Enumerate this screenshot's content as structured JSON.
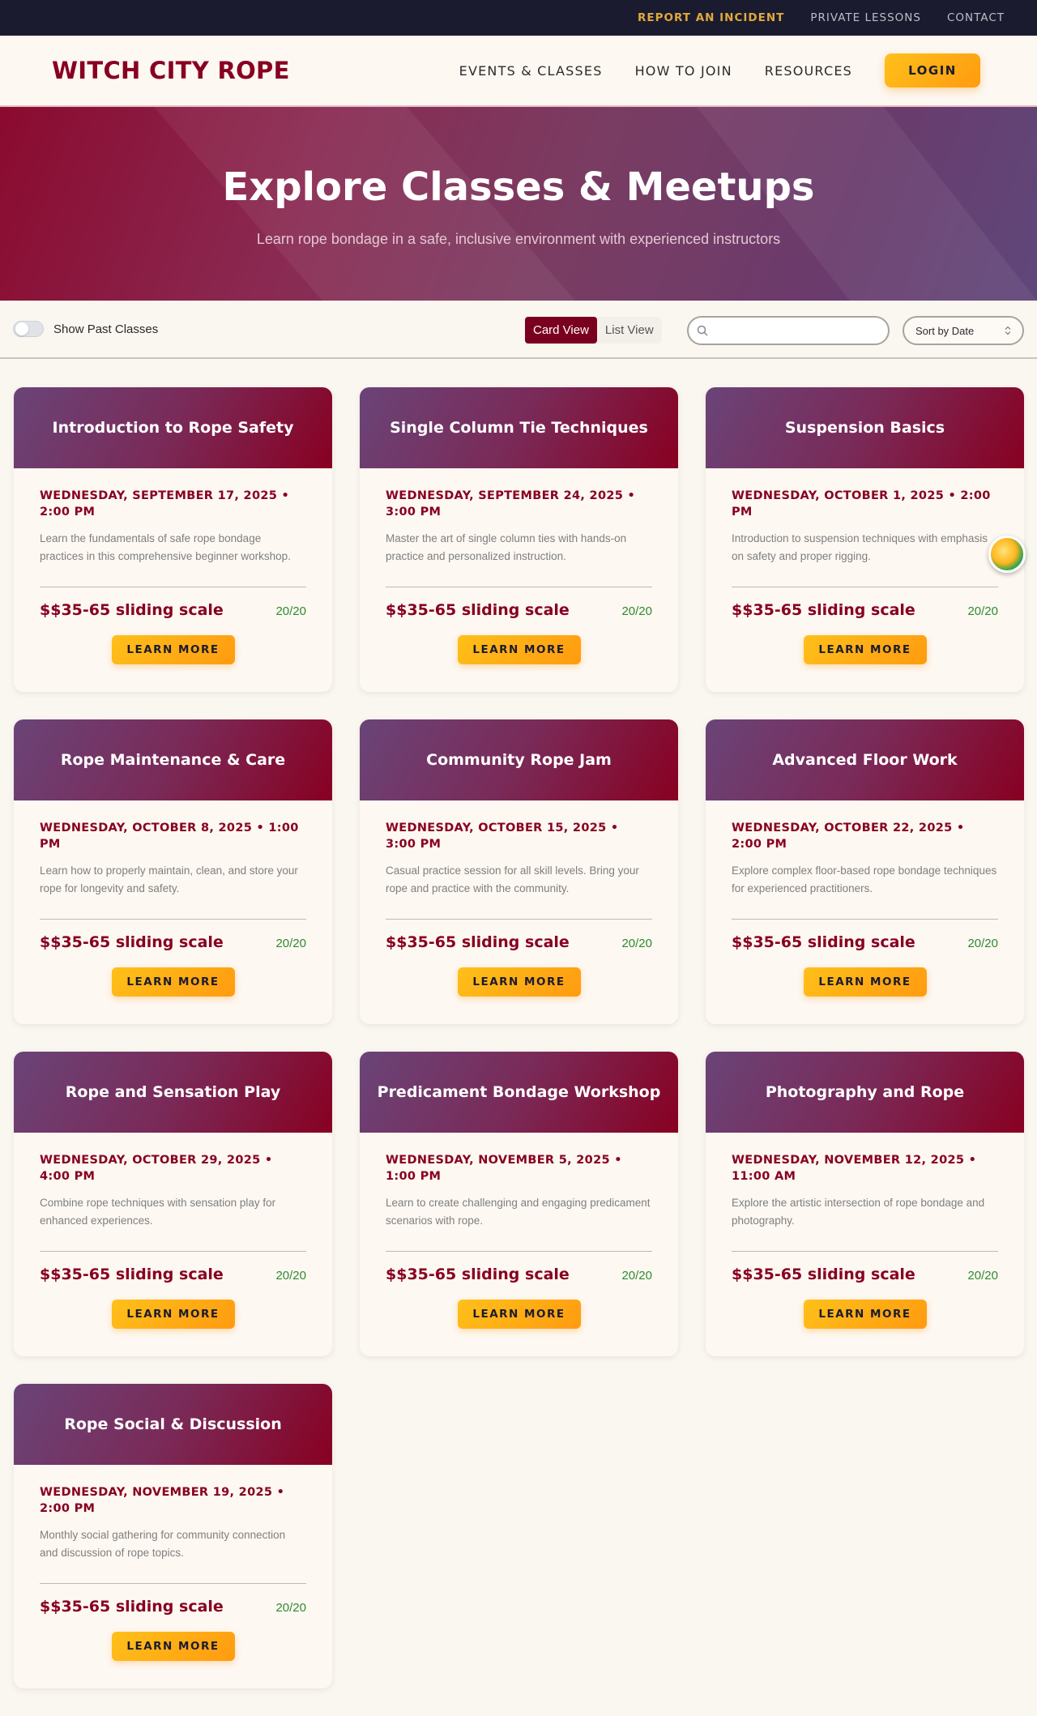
{
  "utility_nav": {
    "report": "REPORT AN INCIDENT",
    "lessons": "PRIVATE LESSONS",
    "contact": "CONTACT"
  },
  "header": {
    "logo": "WITCH CITY ROPE",
    "nav": [
      "EVENTS & CLASSES",
      "HOW TO JOIN",
      "RESOURCES"
    ],
    "login": "LOGIN"
  },
  "hero": {
    "title": "Explore Classes & Meetups",
    "subtitle": "Learn rope bondage in a safe, inclusive environment with experienced instructors"
  },
  "filters": {
    "show_past": "Show Past Classes",
    "card_view": "Card View",
    "list_view": "List View",
    "search_placeholder": "",
    "sort": "Sort by Date"
  },
  "learn_more": "LEARN MORE",
  "events": [
    {
      "title": "Introduction to Rope Safety",
      "date": "WEDNESDAY, SEPTEMBER 17, 2025 • 2:00 PM",
      "desc": "Learn the fundamentals of safe rope bondage practices in this comprehensive beginner workshop.",
      "price": "$$35-65 sliding scale",
      "capacity": "20/20"
    },
    {
      "title": "Single Column Tie Techniques",
      "date": "WEDNESDAY, SEPTEMBER 24, 2025 • 3:00 PM",
      "desc": "Master the art of single column ties with hands-on practice and personalized instruction.",
      "price": "$$35-65 sliding scale",
      "capacity": "20/20"
    },
    {
      "title": "Suspension Basics",
      "date": "WEDNESDAY, OCTOBER 1, 2025 • 2:00 PM",
      "desc": "Introduction to suspension techniques with emphasis on safety and proper rigging.",
      "price": "$$35-65 sliding scale",
      "capacity": "20/20"
    },
    {
      "title": "Rope Maintenance & Care",
      "date": "WEDNESDAY, OCTOBER 8, 2025 • 1:00 PM",
      "desc": "Learn how to properly maintain, clean, and store your rope for longevity and safety.",
      "price": "$$35-65 sliding scale",
      "capacity": "20/20"
    },
    {
      "title": "Community Rope Jam",
      "date": "WEDNESDAY, OCTOBER 15, 2025 • 3:00 PM",
      "desc": "Casual practice session for all skill levels. Bring your rope and practice with the community.",
      "price": "$$35-65 sliding scale",
      "capacity": "20/20"
    },
    {
      "title": "Advanced Floor Work",
      "date": "WEDNESDAY, OCTOBER 22, 2025 • 2:00 PM",
      "desc": "Explore complex floor-based rope bondage techniques for experienced practitioners.",
      "price": "$$35-65 sliding scale",
      "capacity": "20/20"
    },
    {
      "title": "Rope and Sensation Play",
      "date": "WEDNESDAY, OCTOBER 29, 2025 • 4:00 PM",
      "desc": "Combine rope techniques with sensation play for enhanced experiences.",
      "price": "$$35-65 sliding scale",
      "capacity": "20/20"
    },
    {
      "title": "Predicament Bondage Workshop",
      "date": "WEDNESDAY, NOVEMBER 5, 2025 • 1:00 PM",
      "desc": "Learn to create challenging and engaging predicament scenarios with rope.",
      "price": "$$35-65 sliding scale",
      "capacity": "20/20"
    },
    {
      "title": "Photography and Rope",
      "date": "WEDNESDAY, NOVEMBER 12, 2025 • 11:00 AM",
      "desc": "Explore the artistic intersection of rope bondage and photography.",
      "price": "$$35-65 sliding scale",
      "capacity": "20/20"
    },
    {
      "title": "Rope Social & Discussion",
      "date": "WEDNESDAY, NOVEMBER 19, 2025 • 2:00 PM",
      "desc": "Monthly social gathering for community connection and discussion of rope topics.",
      "price": "$$35-65 sliding scale",
      "capacity": "20/20"
    }
  ],
  "colors": {
    "brand": "#880021",
    "accent": "#ffb115",
    "dark": "#1b1b2f",
    "success": "#2e8b2e"
  }
}
